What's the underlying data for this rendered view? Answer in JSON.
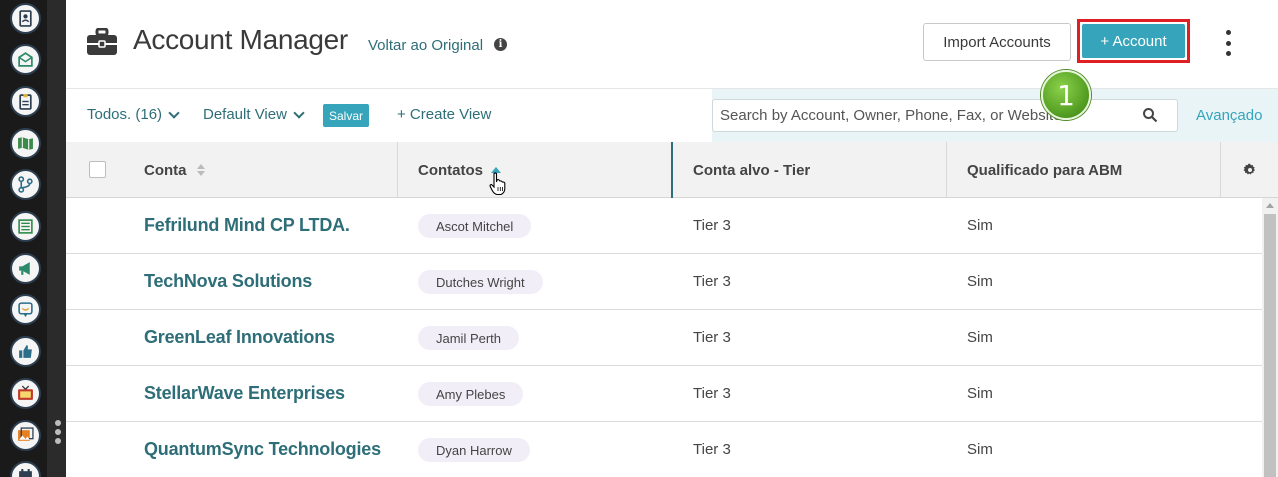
{
  "header": {
    "title": "Account Manager",
    "revert_link": "Voltar ao Original",
    "import_button": "Import Accounts",
    "add_button": "+ Account",
    "step_badge": "1"
  },
  "toolbar": {
    "filter_label": "Todos. (16)",
    "view_label": "Default View",
    "save_label": "Salvar",
    "create_view": "+ Create View",
    "search_placeholder": "Search by Account, Owner, Phone, Fax, or Website",
    "advanced_link": "Avançado"
  },
  "table": {
    "columns": [
      "Conta",
      "Contatos",
      "Conta alvo - Tier",
      "Qualificado para ABM"
    ],
    "sorted_column": "Contatos",
    "rows": [
      {
        "account": "Fefrilund Mind CP LTDA.",
        "contact": "Ascot Mitchel",
        "tier": "Tier 3",
        "abm": "Sim"
      },
      {
        "account": "TechNova Solutions",
        "contact": "Dutches Wright",
        "tier": "Tier 3",
        "abm": "Sim"
      },
      {
        "account": "GreenLeaf Innovations",
        "contact": "Jamil Perth",
        "tier": "Tier 3",
        "abm": "Sim"
      },
      {
        "account": "StellarWave Enterprises",
        "contact": "Amy Plebes",
        "tier": "Tier 3",
        "abm": "Sim"
      },
      {
        "account": "QuantumSync Technologies",
        "contact": "Dyan Harrow",
        "tier": "Tier 3",
        "abm": "Sim"
      }
    ]
  },
  "sidebar": {
    "icons": [
      "contacts-icon",
      "email-icon",
      "clipboard-icon",
      "map-icon",
      "branch-icon",
      "list-icon",
      "megaphone-icon",
      "chat-icon",
      "thumbs-up-icon",
      "tv-icon",
      "gallery-icon",
      "calendar-icon"
    ]
  },
  "colors": {
    "accent": "#36a4ba",
    "link": "#2e6e78",
    "highlight": "#e01e25",
    "badge": "#5aa72a"
  }
}
